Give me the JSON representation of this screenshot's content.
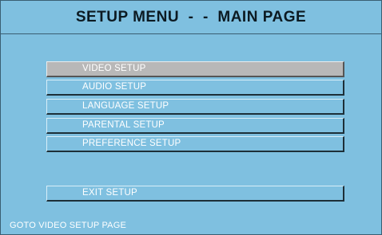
{
  "header": {
    "title": "SETUP MENU  -  -  MAIN PAGE"
  },
  "menu": {
    "items": [
      {
        "label": "VIDEO SETUP",
        "selected": true
      },
      {
        "label": "AUDIO SETUP",
        "selected": false
      },
      {
        "label": "LANGUAGE SETUP",
        "selected": false
      },
      {
        "label": "PARENTAL SETUP",
        "selected": false
      },
      {
        "label": "PREFERENCE SETUP",
        "selected": false
      }
    ],
    "exit_label": "EXIT SETUP"
  },
  "status": {
    "text": "GOTO VIDEO SETUP PAGE"
  },
  "colors": {
    "background": "#7fc0e0",
    "selected": "#b8b8b8",
    "text": "#ffffff"
  }
}
